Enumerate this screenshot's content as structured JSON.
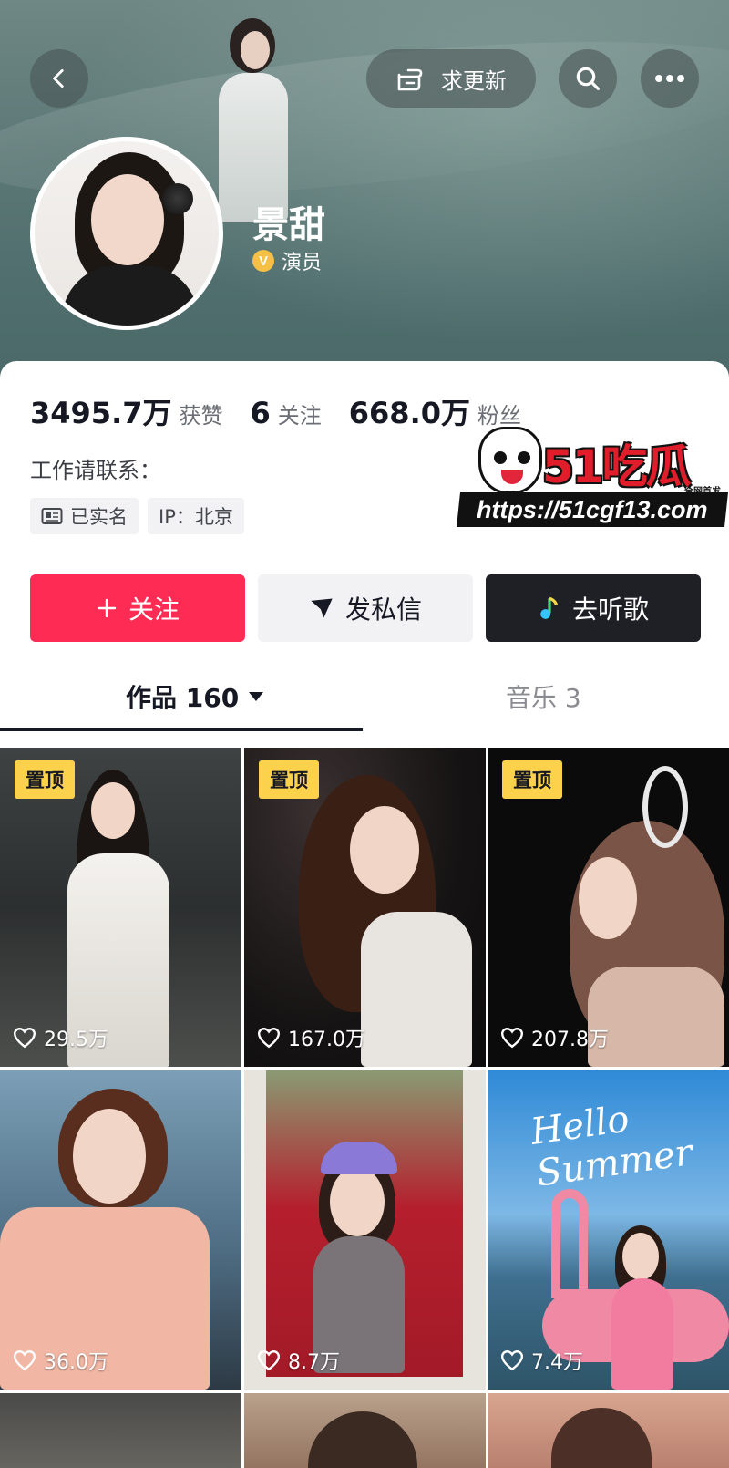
{
  "header": {
    "update_label": "求更新",
    "name": "景甜",
    "verify_badge": "V",
    "role": "演员"
  },
  "stats": [
    {
      "value": "3495.7万",
      "label": "获赞"
    },
    {
      "value": "6",
      "label": "关注"
    },
    {
      "value": "668.0万",
      "label": "粉丝"
    }
  ],
  "contact_label": "工作请联系：",
  "tags": {
    "real_name": "已实名",
    "ip": "IP：北京"
  },
  "watermark": {
    "logo": "51吃瓜",
    "slogan": "全网首发",
    "url": "https://51cgf13.com"
  },
  "actions": {
    "follow": "关注",
    "message": "发私信",
    "music": "去听歌"
  },
  "tabs": {
    "works_label": "作品 160",
    "music_label": "音乐 3"
  },
  "pin_label": "置顶",
  "videos": [
    {
      "likes": "29.5万",
      "pinned": true
    },
    {
      "likes": "167.0万",
      "pinned": true
    },
    {
      "likes": "207.8万",
      "pinned": true
    },
    {
      "likes": "36.0万",
      "pinned": false
    },
    {
      "likes": "8.7万",
      "pinned": false
    },
    {
      "likes": "7.4万",
      "pinned": false
    }
  ],
  "hello_text": "Hello Summer",
  "colors": {
    "primary": "#fe2c55",
    "pin_badge": "#fcd24d",
    "verify": "#f5c045",
    "dark_button": "#1f1f26"
  }
}
